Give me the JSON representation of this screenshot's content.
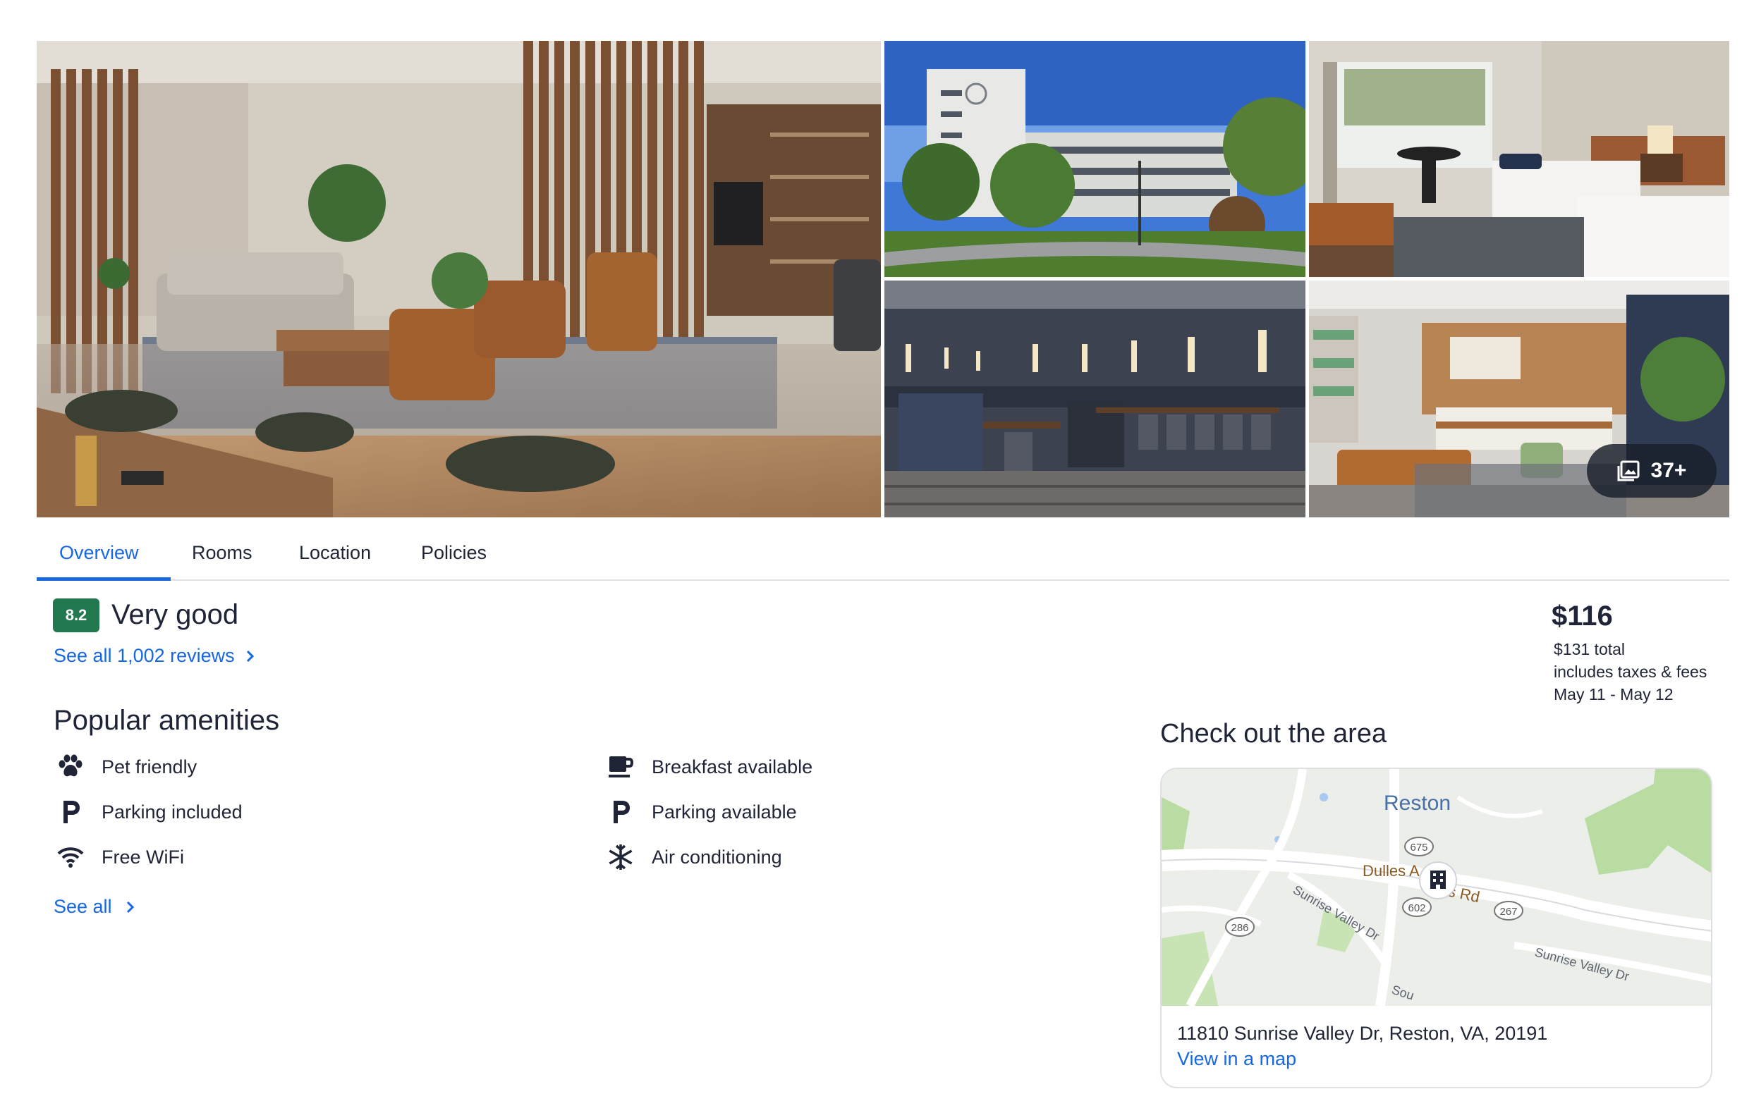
{
  "gallery": {
    "photo_count": "37+",
    "photos": [
      "lobby-lounge",
      "hotel-exterior",
      "guest-room",
      "restaurant",
      "lobby-front-desk"
    ]
  },
  "tabs": [
    {
      "label": "Overview",
      "active": true
    },
    {
      "label": "Rooms",
      "active": false
    },
    {
      "label": "Location",
      "active": false
    },
    {
      "label": "Policies",
      "active": false
    }
  ],
  "rating": {
    "score": "8.2",
    "label": "Very good",
    "reviews_link": "See all 1,002 reviews",
    "badge_color": "#227950"
  },
  "price": {
    "nightly": "$116",
    "total": "$131 total",
    "note": "includes taxes & fees",
    "dates": "May 11 - May 12"
  },
  "amenities": {
    "title": "Popular amenities",
    "items": [
      {
        "label": "Pet friendly",
        "icon": "paw-icon"
      },
      {
        "label": "Parking included",
        "icon": "parking-icon"
      },
      {
        "label": "Free WiFi",
        "icon": "wifi-icon"
      },
      {
        "label": "Breakfast available",
        "icon": "coffee-cup-icon"
      },
      {
        "label": "Parking available",
        "icon": "parking-icon"
      },
      {
        "label": "Air conditioning",
        "icon": "snowflake-icon"
      }
    ],
    "see_all": "See all"
  },
  "area": {
    "title": "Check out the area",
    "map_labels": {
      "town": "Reston",
      "road_main": "Dulles A",
      "road_main_suffix": "s Rd",
      "road_sunrise_1": "Sunrise Valley Dr",
      "road_sunrise_2": "Sunrise Valley Dr",
      "road_south": "Sou",
      "shield_675": "675",
      "shield_602": "602",
      "shield_286": "286",
      "shield_267": "267"
    },
    "address": "11810 Sunrise Valley Dr, Reston, VA, 20191",
    "view_map": "View in a map"
  },
  "colors": {
    "accent": "#1668e3",
    "text": "#1f2537",
    "divider": "#dfe0e4"
  }
}
